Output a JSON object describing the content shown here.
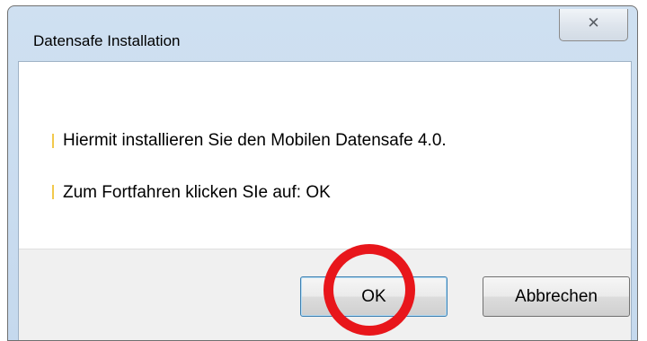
{
  "window": {
    "title": "Datensafe Installation",
    "close_glyph": "✕"
  },
  "message": {
    "line1": "Hiermit installieren Sie den Mobilen Datensafe 4.0.",
    "line2": "Zum Fortfahren klicken SIe auf: OK"
  },
  "buttons": {
    "ok_label": "OK",
    "cancel_label": "Abbrechen"
  },
  "annotation": {
    "highlight": "ok-button",
    "color": "#e8161b"
  },
  "colors": {
    "titlebar": "#c5d9ee",
    "footer": "#f0f0f0",
    "default_button_border": "#3c7fb1"
  },
  "icons": {
    "close": "close-icon"
  }
}
